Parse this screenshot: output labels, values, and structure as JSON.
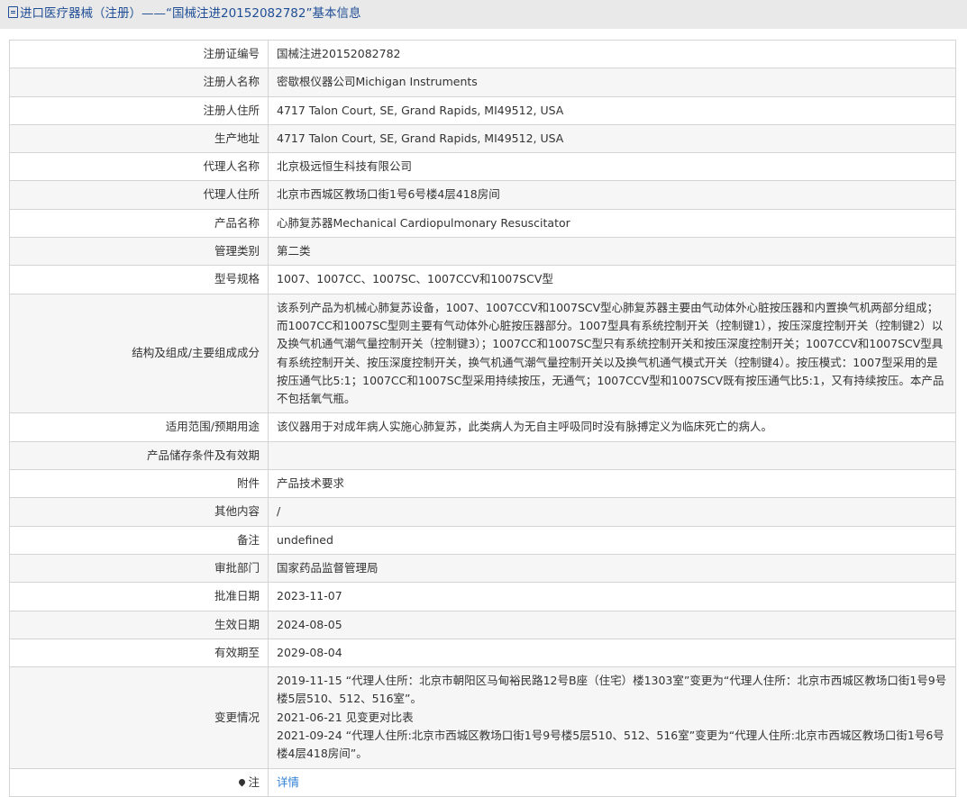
{
  "title": "进口医疗器械（注册）——“国械注进20152082782”基本信息",
  "rows": [
    {
      "label": "注册证编号",
      "value": "国械注进20152082782"
    },
    {
      "label": "注册人名称",
      "value": "密歇根仪器公司Michigan Instruments"
    },
    {
      "label": "注册人住所",
      "value": "4717 Talon Court, SE, Grand Rapids, MI49512, USA"
    },
    {
      "label": "生产地址",
      "value": "4717 Talon Court, SE, Grand Rapids, MI49512, USA"
    },
    {
      "label": "代理人名称",
      "value": "北京极远恒生科技有限公司"
    },
    {
      "label": "代理人住所",
      "value": "北京市西城区教场口街1号6号楼4层418房间"
    },
    {
      "label": "产品名称",
      "value": "心肺复苏器Mechanical Cardiopulmonary Resuscitator"
    },
    {
      "label": "管理类别",
      "value": "第二类"
    },
    {
      "label": "型号规格",
      "value": "1007、1007CC、1007SC、1007CCV和1007SCV型"
    },
    {
      "label": "结构及组成/主要组成成分",
      "value": "该系列产品为机械心肺复苏设备，1007、1007CCV和1007SCV型心肺复苏器主要由气动体外心脏按压器和内置换气机两部分组成；而1007CC和1007SC型则主要有气动体外心脏按压器部分。1007型具有系统控制开关（控制键1），按压深度控制开关（控制键2）以及换气机通气潮气量控制开关（控制键3）；1007CC和1007SC型只有系统控制开关和按压深度控制开关；1007CCV和1007SCV型具有系统控制开关、按压深度控制开关，换气机通气潮气量控制开关以及换气机通气模式开关（控制键4）。按压模式：1007型采用的是按压通气比5:1；1007CC和1007SC型采用持续按压，无通气；1007CCV型和1007SCV既有按压通气比5:1，又有持续按压。本产品不包括氧气瓶。"
    },
    {
      "label": "适用范围/预期用途",
      "value": "该仪器用于对成年病人实施心肺复苏，此类病人为无自主呼吸同时没有脉搏定义为临床死亡的病人。"
    },
    {
      "label": "产品储存条件及有效期",
      "value": ""
    },
    {
      "label": "附件",
      "value": "产品技术要求"
    },
    {
      "label": "其他内容",
      "value": "/"
    },
    {
      "label": "备注",
      "value": "undefined"
    },
    {
      "label": "审批部门",
      "value": "国家药品监督管理局"
    },
    {
      "label": "批准日期",
      "value": "2023-11-07"
    },
    {
      "label": "生效日期",
      "value": "2024-08-05"
    },
    {
      "label": "有效期至",
      "value": "2029-08-04"
    }
  ],
  "changes": {
    "label": "变更情况",
    "items": [
      "2019-11-15 “代理人住所：北京市朝阳区马甸裕民路12号B座（住宅）楼1303室”变更为“代理人住所：北京市西城区教场口街1号9号楼5层510、512、516室”。",
      "2021-06-21 见变更对比表",
      "2021-09-24 “代理人住所:北京市西城区教场口街1号9号楼5层510、512、516室”变更为“代理人住所:北京市西城区教场口街1号6号楼4层418房间”。"
    ]
  },
  "note": {
    "label": "注",
    "link": "详情"
  }
}
